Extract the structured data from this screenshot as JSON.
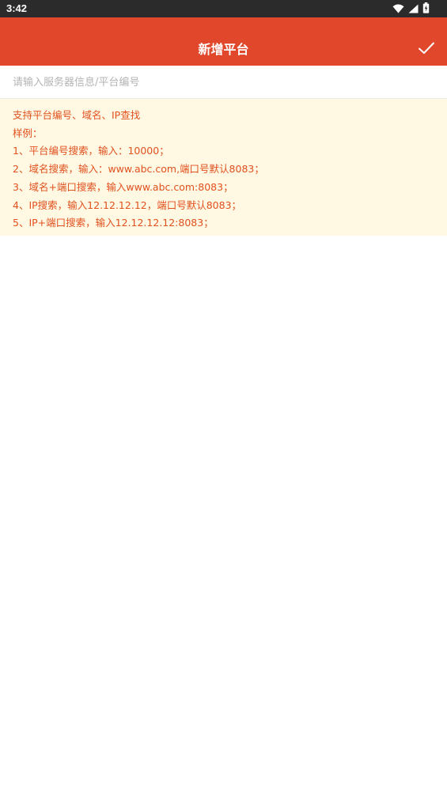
{
  "status_bar": {
    "time": "3:42",
    "icons": [
      "wifi-icon",
      "signal-icon",
      "battery-icon"
    ]
  },
  "app_bar": {
    "title": "新增平台",
    "confirm_icon": "checkmark-icon",
    "background_color": "#e1472a"
  },
  "search": {
    "placeholder": "请输入服务器信息/平台编号",
    "value": ""
  },
  "hint": {
    "background_color": "#fff8e3",
    "text_color": "#e1511e",
    "lines": [
      "支持平台编号、域名、IP查找",
      "样例：",
      "1、平台编号搜索，输入：10000；",
      "2、域名搜索，输入：www.abc.com,端口号默认8083；",
      "3、域名+端口搜索，输入www.abc.com:8083；",
      "4、IP搜索，输入12.12.12.12，端口号默认8083；",
      "5、IP+端口搜索，输入12.12.12.12:8083；"
    ]
  }
}
